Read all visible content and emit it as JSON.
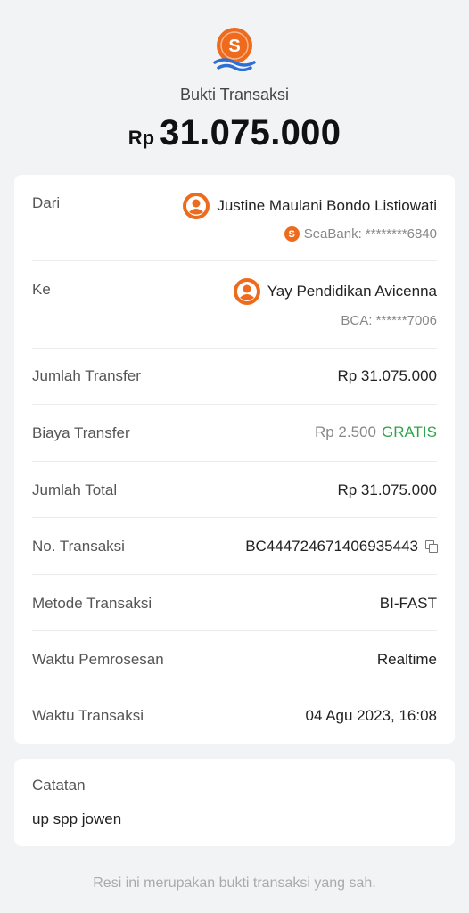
{
  "brand": {
    "logo_letter": "S",
    "accent": "#ee6a1c",
    "wave_color": "#2d6fd6"
  },
  "header": {
    "title": "Bukti Transaksi",
    "currency": "Rp",
    "amount": "31.075.000"
  },
  "from": {
    "label": "Dari",
    "name": "Justine Maulani Bondo Listiowati",
    "bank_logo_letter": "S",
    "account": "SeaBank: ********6840"
  },
  "to": {
    "label": "Ke",
    "name": "Yay Pendidikan Avicenna",
    "account": "BCA: ******7006"
  },
  "details": {
    "transfer_amount_label": "Jumlah Transfer",
    "transfer_amount": "Rp 31.075.000",
    "fee_label": "Biaya Transfer",
    "fee_original": "Rp 2.500",
    "fee_free": "GRATIS",
    "total_label": "Jumlah Total",
    "total": "Rp 31.075.000",
    "txn_no_label": "No. Transaksi",
    "txn_no": "BC444724671406935443",
    "method_label": "Metode Transaksi",
    "method": "BI-FAST",
    "processing_label": "Waktu Pemrosesan",
    "processing": "Realtime",
    "time_label": "Waktu Transaksi",
    "time": "04 Agu 2023, 16:08"
  },
  "note": {
    "label": "Catatan",
    "text": "up spp jowen"
  },
  "footer": "Resi ini merupakan bukti transaksi yang sah.",
  "icons": [
    "seabank-logo-icon",
    "user-avatar-icon",
    "copy-icon"
  ],
  "colors": {
    "accent": "#ee6a1c",
    "success": "#2ea34a",
    "background": "#f2f3f5"
  }
}
